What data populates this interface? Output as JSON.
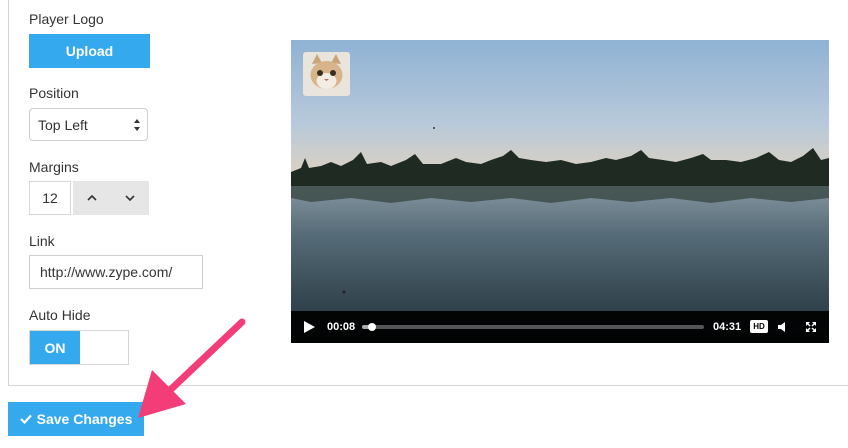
{
  "form": {
    "player_logo_label": "Player Logo",
    "upload_label": "Upload",
    "position_label": "Position",
    "position_value": "Top Left",
    "margins_label": "Margins",
    "margins_value": "12",
    "link_label": "Link",
    "link_value": "http://www.zype.com/",
    "auto_hide_label": "Auto Hide",
    "auto_hide_state": "ON"
  },
  "player": {
    "current_time": "00:08",
    "duration": "04:31",
    "progress": 0.03,
    "hd_label": "HD",
    "logo_icon": "cat-logo-icon",
    "controls_icons": [
      "play-icon",
      "volume-icon",
      "fullscreen-icon"
    ]
  },
  "footer": {
    "save_label": "Save Changes"
  },
  "colors": {
    "accent": "#35a9ee",
    "annotation_arrow": "#f23d79"
  }
}
